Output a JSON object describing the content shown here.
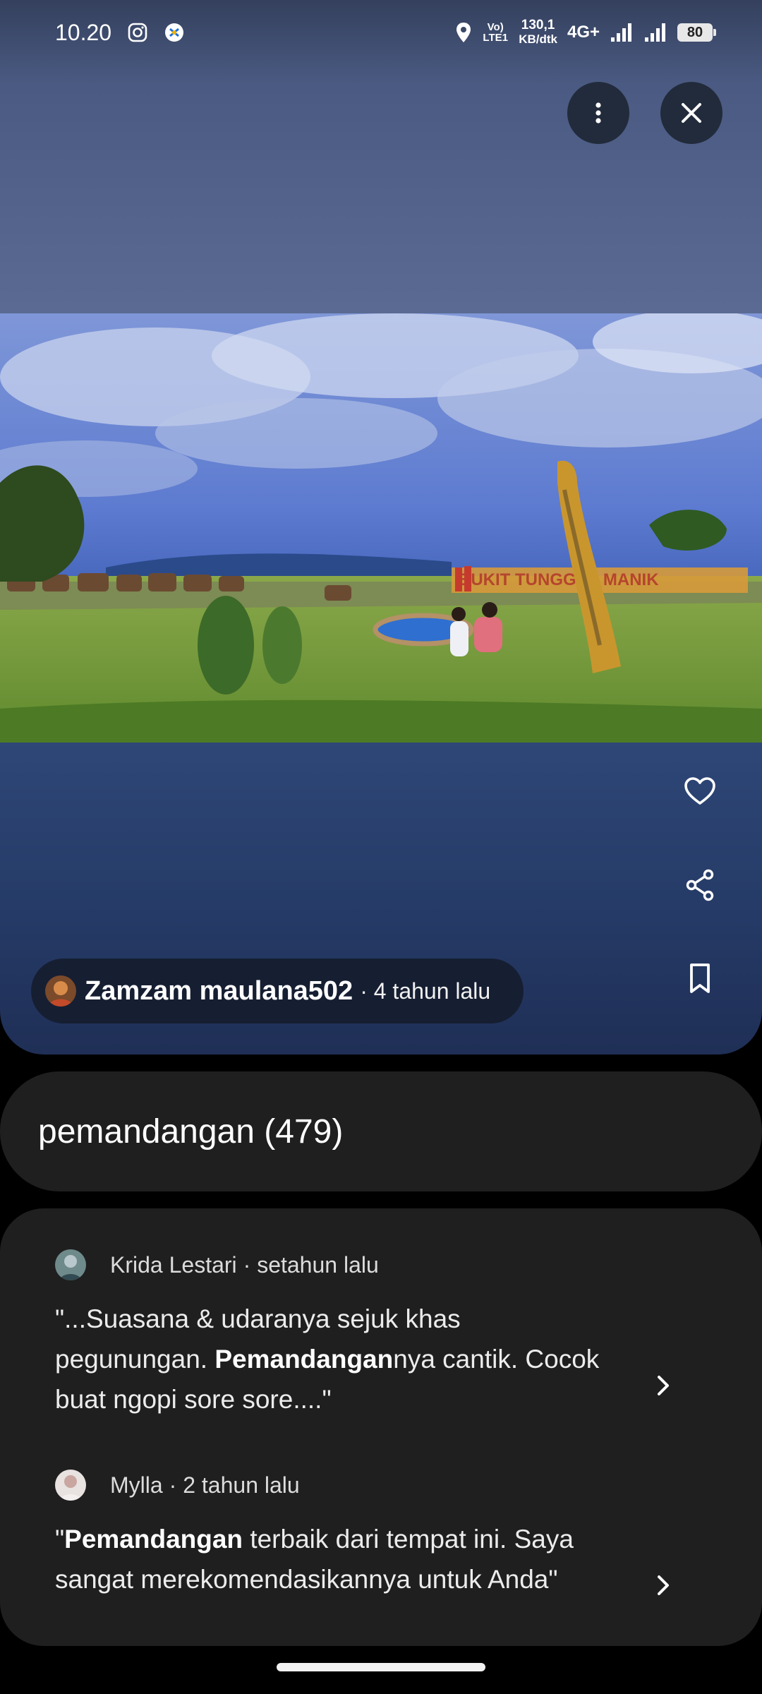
{
  "status_bar": {
    "time": "10.20",
    "volte": "Vo) LTE1",
    "speed_value": "130,1",
    "speed_unit": "KB/dtk",
    "network": "4G+",
    "battery": "80"
  },
  "photo": {
    "sign_text": "BUKIT TUNGGUL MANIK"
  },
  "author": {
    "name": "Zamzam maulana502",
    "time": "· 4 tahun lalu"
  },
  "search_topic": "pemandangan (479)",
  "reviews": [
    {
      "author": "Krida Lestari",
      "time": "· setahun lalu",
      "text_1": "\"...Suasana & udaranya sejuk khas pegunungan. ",
      "highlight": "Pemandangan",
      "text_2": "nya cantik. Cocok buat ngopi sore sore....\""
    },
    {
      "author": "Mylla",
      "time": "· 2 tahun lalu",
      "text_1": "\"",
      "highlight": "Pemandangan",
      "text_2": " terbaik dari tempat ini. Saya sangat merekomendasikannya untuk Anda\""
    }
  ],
  "icons": {
    "more": "more-vert-icon",
    "close": "close-icon",
    "like": "heart-icon",
    "share": "share-icon",
    "save": "bookmark-icon",
    "open": "chevron-right-icon"
  }
}
